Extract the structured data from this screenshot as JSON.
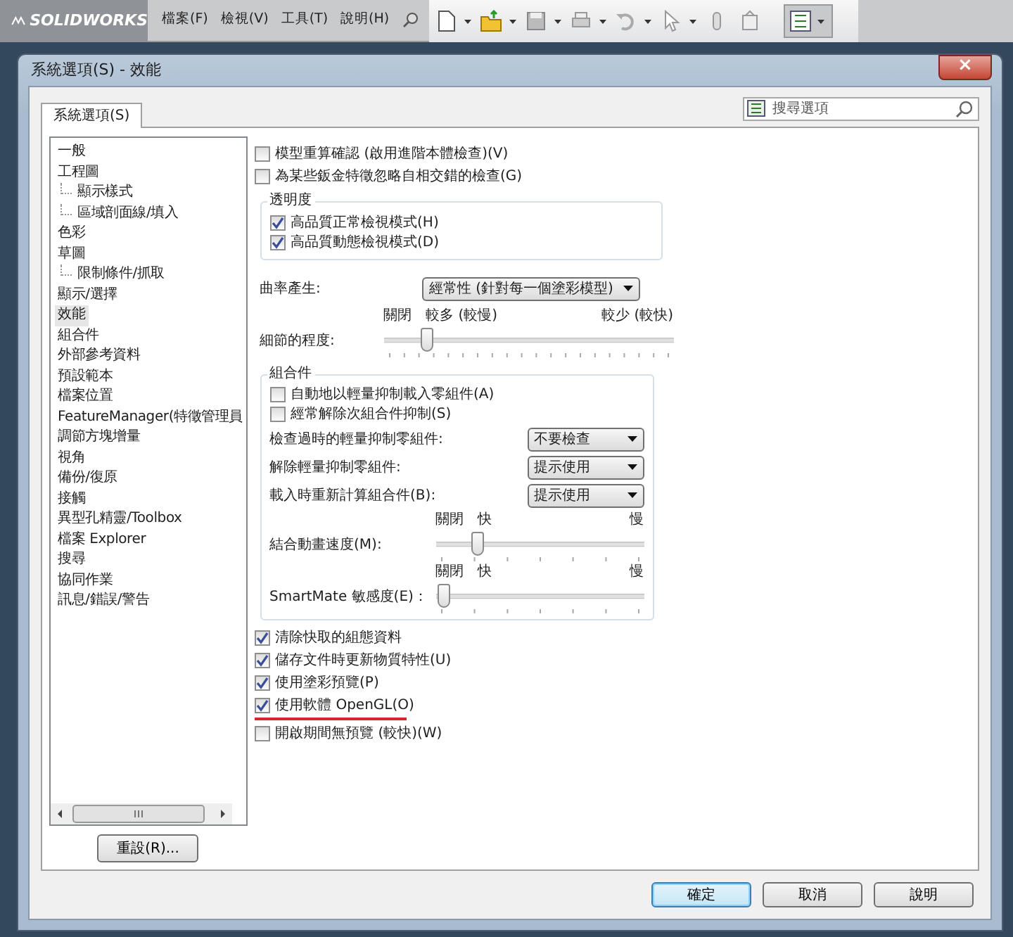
{
  "app_bar": {
    "logo": "SOLIDWORKS",
    "menus": [
      "檔案(F)",
      "檢視(V)",
      "工具(T)",
      "說明(H)"
    ]
  },
  "dialog": {
    "title": "系統選項(S) - 效能",
    "close": "×",
    "tabs": [
      {
        "label": "系統選項(S)",
        "selected": true
      }
    ],
    "search": {
      "placeholder": "搜尋選項"
    },
    "tree": [
      {
        "label": "一般",
        "selected": false
      },
      {
        "label": "工程圖",
        "selected": false,
        "children": [
          {
            "label": "顯示樣式",
            "selected": false
          },
          {
            "label": "區域剖面線/填入",
            "selected": false
          }
        ]
      },
      {
        "label": "色彩",
        "selected": false
      },
      {
        "label": "草圖",
        "selected": false,
        "children": [
          {
            "label": "限制條件/抓取",
            "selected": false
          }
        ]
      },
      {
        "label": "顯示/選擇",
        "selected": false
      },
      {
        "label": "效能",
        "selected": true
      },
      {
        "label": "組合件",
        "selected": false
      },
      {
        "label": "外部參考資料",
        "selected": false
      },
      {
        "label": "預設範本",
        "selected": false
      },
      {
        "label": "檔案位置",
        "selected": false
      },
      {
        "label": "FeatureManager(特徵管理員",
        "selected": false
      },
      {
        "label": "調節方塊增量",
        "selected": false
      },
      {
        "label": "視角",
        "selected": false
      },
      {
        "label": "備份/復原",
        "selected": false
      },
      {
        "label": "接觸",
        "selected": false
      },
      {
        "label": "異型孔精靈/Toolbox",
        "selected": false
      },
      {
        "label": "檔案 Explorer",
        "selected": false
      },
      {
        "label": "搜尋",
        "selected": false
      },
      {
        "label": "協同作業",
        "selected": false
      },
      {
        "label": "訊息/錯誤/警告",
        "selected": false
      }
    ],
    "reset_button": "重設(R)...",
    "settings": [
      {
        "kind": "checkbox",
        "label": "模型重算確認 (啟用進階本體檢查)(V)",
        "checked": false,
        "underlined": false
      },
      {
        "kind": "checkbox",
        "label": "為某些鈑金特徵忽略自相交錯的檢查(G)",
        "checked": false,
        "underlined": false
      },
      {
        "kind": "group",
        "title": "透明度",
        "items": [
          {
            "kind": "checkbox",
            "label": "高品質正常檢視模式(H)",
            "checked": true,
            "underlined": false
          },
          {
            "kind": "checkbox",
            "label": "高品質動態檢視模式(D)",
            "checked": true,
            "underlined": false
          }
        ]
      },
      {
        "kind": "select",
        "label": "曲率產生:",
        "value": "經常性 (針對每一個塗彩模型)",
        "wide": true
      },
      {
        "kind": "slider",
        "label": "細節的程度:",
        "labels": [
          "關閉",
          "較多 (較慢)",
          "較少 (較快)"
        ],
        "level": 0.13
      },
      {
        "kind": "group",
        "title": "組合件",
        "items": [
          {
            "kind": "checkbox",
            "label": "自動地以輕量抑制載入零組件(A)",
            "checked": false,
            "underlined": false
          },
          {
            "kind": "checkbox",
            "label": "經常解除次組合件抑制(S)",
            "checked": false,
            "underlined": false
          },
          {
            "kind": "select",
            "label": "檢查過時的輕量抑制零組件:",
            "value": "不要檢查",
            "wide": false
          },
          {
            "kind": "select",
            "label": "解除輕量抑制零組件:",
            "value": "提示使用",
            "wide": false
          },
          {
            "kind": "select",
            "label": "載入時重新計算組合件(B):",
            "value": "提示使用",
            "wide": false
          },
          {
            "kind": "slider",
            "label": "結合動畫速度(M):",
            "labels": [
              "關閉",
              "快",
              "慢"
            ],
            "level": 0.18
          },
          {
            "kind": "slider",
            "label": "SmartMate 敏感度(E)：",
            "labels": [
              "關閉",
              "快",
              "慢"
            ],
            "level": 0
          }
        ]
      },
      {
        "kind": "checkbox",
        "label": "清除快取的組態資料",
        "checked": true,
        "underlined": false
      },
      {
        "kind": "checkbox",
        "label": "儲存文件時更新物質特性(U)",
        "checked": true,
        "underlined": false
      },
      {
        "kind": "checkbox",
        "label": "使用塗彩預覽(P)",
        "checked": true,
        "underlined": false
      },
      {
        "kind": "checkbox",
        "label": "使用軟體 OpenGL(O)",
        "checked": true,
        "underlined": true
      },
      {
        "kind": "checkbox",
        "label": "開啟期間無預覽 (較快)(W)",
        "checked": false,
        "underlined": false
      }
    ],
    "buttons": [
      {
        "label": "確定",
        "default": true
      },
      {
        "label": "取消",
        "default": false
      },
      {
        "label": "說明",
        "default": false
      }
    ]
  }
}
